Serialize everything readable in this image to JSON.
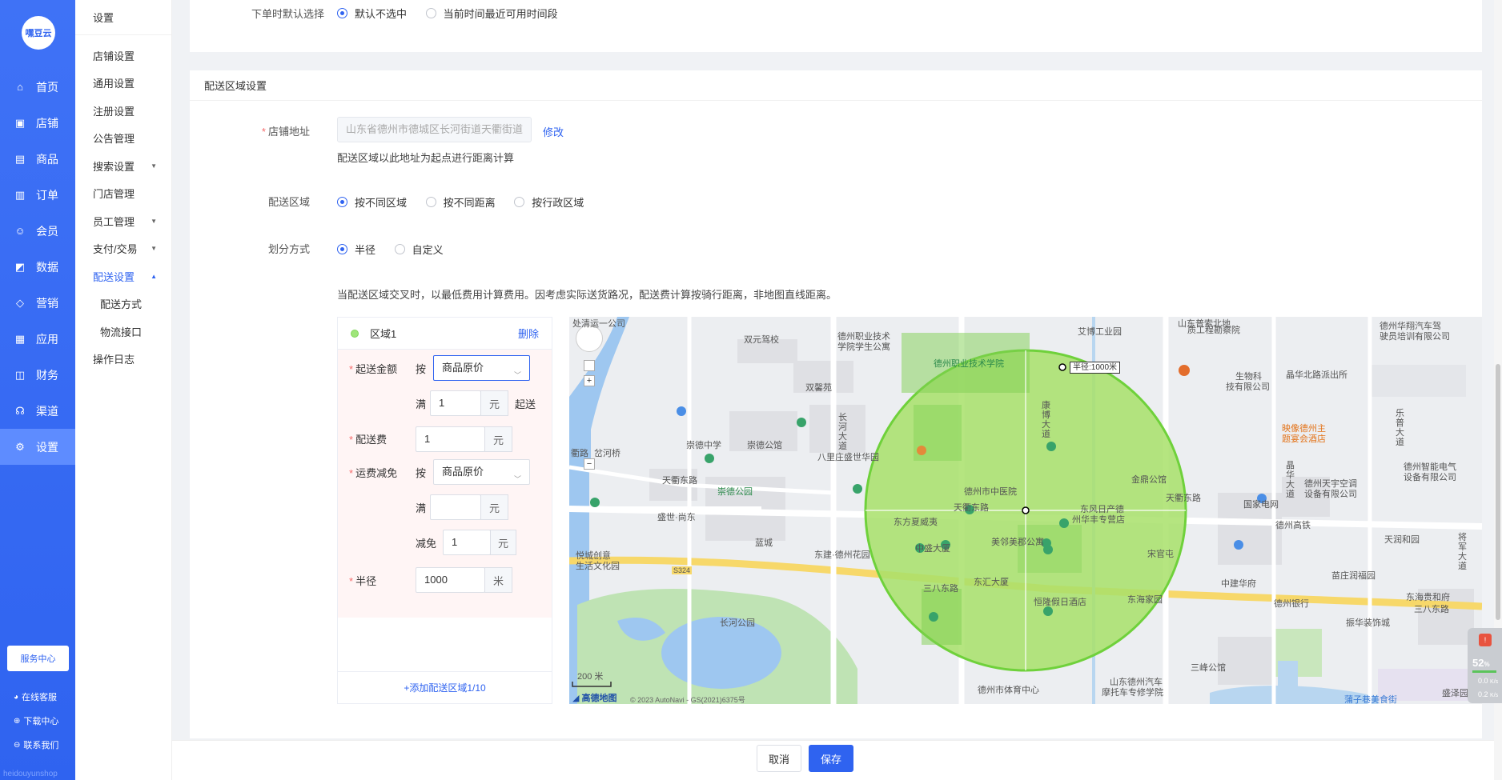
{
  "sidebar": {
    "logo": "嘿豆云",
    "items": [
      {
        "label": "首页",
        "icon": "home-icon"
      },
      {
        "label": "店铺",
        "icon": "store-icon"
      },
      {
        "label": "商品",
        "icon": "goods-icon"
      },
      {
        "label": "订单",
        "icon": "order-icon"
      },
      {
        "label": "会员",
        "icon": "member-icon"
      },
      {
        "label": "数据",
        "icon": "chart-icon"
      },
      {
        "label": "营销",
        "icon": "tag-icon"
      },
      {
        "label": "应用",
        "icon": "app-icon"
      },
      {
        "label": "财务",
        "icon": "finance-icon"
      },
      {
        "label": "渠道",
        "icon": "channel-icon"
      },
      {
        "label": "设置",
        "icon": "gear-icon"
      }
    ],
    "service_center": "服务中心",
    "links": [
      {
        "label": "在线客服",
        "icon": "chat-icon"
      },
      {
        "label": "下载中心",
        "icon": "download-icon"
      },
      {
        "label": "联系我们",
        "icon": "contact-icon"
      }
    ],
    "watermark": "heidouyunshop"
  },
  "submenu": {
    "title": "设置",
    "items": [
      {
        "label": "店铺设置"
      },
      {
        "label": "通用设置"
      },
      {
        "label": "注册设置"
      },
      {
        "label": "公告管理"
      },
      {
        "label": "搜索设置"
      },
      {
        "label": "门店管理"
      },
      {
        "label": "员工管理"
      },
      {
        "label": "支付/交易"
      },
      {
        "label": "配送设置"
      },
      {
        "label": "配送方式"
      },
      {
        "label": "物流接口"
      },
      {
        "label": "操作日志"
      }
    ]
  },
  "top_section": {
    "label": "下单时默认选择",
    "options": [
      "默认不选中",
      "当前时间最近可用时间段"
    ]
  },
  "delivery": {
    "title": "配送区域设置",
    "store_address_label": "店铺地址",
    "store_address_value": "山东省德州市德城区长河街道天衢街道",
    "modify": "修改",
    "address_hint": "配送区域以此地址为起点进行距离计算",
    "area_label": "配送区域",
    "area_options": [
      "按不同区域",
      "按不同距离",
      "按行政区域"
    ],
    "division_label": "划分方式",
    "division_options": [
      "半径",
      "自定义"
    ],
    "notice": "当配送区域交叉时，以最低费用计算费用。因考虑实际送货路况，配送费计算按骑行距离，非地图直线距离。"
  },
  "zone": {
    "name": "区域1",
    "delete": "删除",
    "min_amount_label": "起送金额",
    "by": "按",
    "price_type": "商品原价",
    "full": "满",
    "min_amount_value": "1",
    "yuan": "元",
    "start_text": "起送",
    "fee_label": "配送费",
    "fee_value": "1",
    "waiver_label": "运费减免",
    "waiver_price_type": "商品原价",
    "waiver_full_value": "",
    "minus": "减免",
    "waiver_minus_value": "1",
    "radius_label": "半径",
    "radius_value": "1000",
    "meter": "米",
    "add_zone": "+添加配送区域1/10"
  },
  "map": {
    "radius_tag": "半径:1000米",
    "scale": "200 米",
    "brand": "高德地图",
    "copyright": "© 2023 AutoNavi - GS(2021)6375号",
    "labels": [
      "处清运一公司",
      "双元驾校",
      "德州职业技术",
      "学院学生公寓",
      "德州职业技术学院",
      "双馨苑",
      "艾博工业园",
      "山东普索北地",
      "质工程勘察院",
      "德州华翔汽车驾",
      "驶员培训有限公司",
      "晶华北路派出所",
      "德州市中医院",
      "天衢东路",
      "崇德中学",
      "崇德公馆",
      "八里庄盛世华园",
      "衢路",
      "岔河桥",
      "天衢东路",
      "崇德公园",
      "盛世·尚东",
      "东方夏威夷",
      "中盛大厦",
      "美邻美郡公寓",
      "东风日产德",
      "州华丰专营店",
      "金鼎公馆",
      "宋官屯",
      "天衢东路",
      "国家电网",
      "德州高铁",
      "映像德州主",
      "题宴会酒店",
      "天润和园",
      "东建·德州花园",
      "东汇大厦",
      "三八东路",
      "恒隆假日酒店",
      "东海家园",
      "德州银行",
      "三八东路",
      "长河公园",
      "德州市体育中心",
      "山东德州汽车",
      "摩托车专修学院",
      "三峰公馆",
      "苗庄润福园",
      "东海贵和府",
      "振华装饰城",
      "德州天宇空调",
      "设备有限公司",
      "德州智能电气",
      "设备有限公司",
      "蒲子巷美食街",
      "盛泽园花",
      "悦城创意",
      "生活文化园",
      "中建华府",
      "生物科",
      "技有限公司",
      "长河大道",
      "康博大道",
      "晶华大道",
      "乐普大道",
      "将军大道",
      "蓝城",
      "S324"
    ]
  },
  "footer": {
    "cancel": "取消",
    "save": "保存"
  },
  "widget": {
    "percent": "52",
    "percent_unit": "%",
    "speed_up": "0.0",
    "speed_down": "0.2",
    "speed_unit": "K/s"
  },
  "colors": {
    "primary": "#2f63f0",
    "sidebar": "#3f72f6",
    "zone_fill": "#a8e06a",
    "zone_stroke": "#6fd13b",
    "required": "#f56c6c"
  }
}
